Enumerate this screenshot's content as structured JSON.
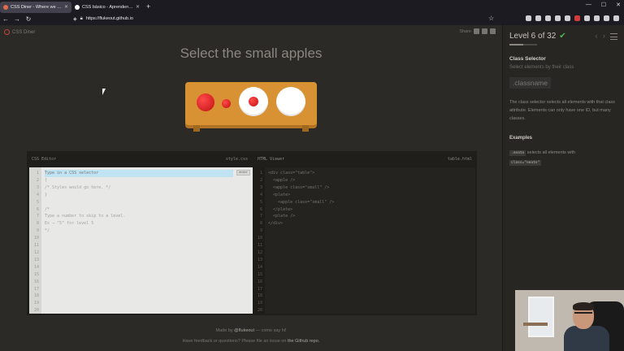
{
  "browser": {
    "tabs": [
      {
        "label": "CSS Diner - Where we feast on CSS",
        "active": true
      },
      {
        "label": "CSS básico - Aprendendo desde o início",
        "active": false
      }
    ],
    "new_tab": "+",
    "url": "https://flukeout.github.io"
  },
  "game": {
    "logo": "CSS Diner",
    "share_label": "Share",
    "instruction": "Select the small apples",
    "editor": {
      "css_title": "CSS Editor",
      "css_file": "style.css",
      "enter_label": "enter",
      "css_lines": [
        "Type in a CSS selector",
        "{",
        "/* Styles would go here. */",
        "}",
        "",
        "/*",
        "Type a number to skip to a level.",
        "Ex → \"5\" for level 5",
        "*/"
      ],
      "html_title": "HTML Viewer",
      "html_file": "table.html",
      "html_lines": [
        "<div class=\"table\">",
        "  <apple />",
        "  <apple class=\"small\" />",
        "  <plate>",
        "    <apple class=\"small\" />",
        "  </plate>",
        "  <plate />",
        "</div>"
      ],
      "line_count": 20
    },
    "footer": {
      "made_by_prefix": "Made by",
      "made_by_name": "@flukeout",
      "made_by_suffix": "— come say hi!",
      "feedback_prefix": "Have feedback or questions? Please file an issue on",
      "feedback_link": "the Github repo."
    }
  },
  "sidebar": {
    "level_text": "Level 6 of 32",
    "progress": 0.5,
    "selector_name": "Class Selector",
    "selector_sub": "Select elements by their class",
    "selector_syntax": ".classname",
    "description": "The class selector selects all elements with that class attribute. Elements can only have one ID, but many classes.",
    "examples_title": "Examples",
    "example_code": ".neato",
    "example_text": "selects all elements with",
    "example_attr": "class=\"neato\""
  },
  "colors": {
    "apple": "#e01f1f",
    "table": "#d99233",
    "check": "#4bb74b"
  }
}
